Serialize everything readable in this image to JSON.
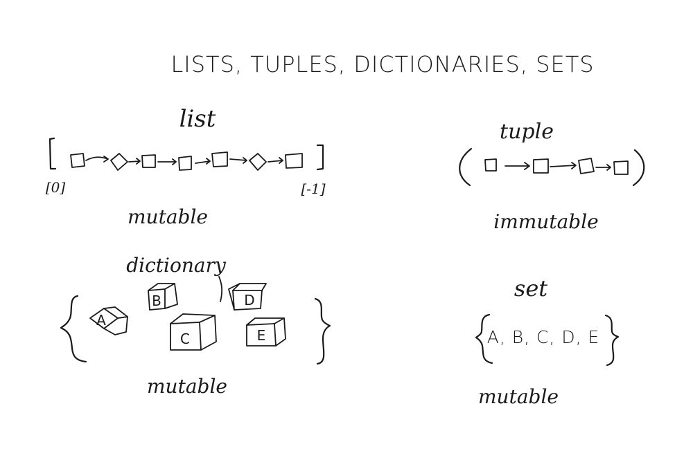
{
  "title": "LISTS, TUPLES, DICTIONARIES, SETS",
  "list": {
    "heading": "list",
    "first_index": "[0]",
    "last_index": "[-1]",
    "mutability": "mutable"
  },
  "tuple": {
    "heading": "tuple",
    "mutability": "immutable"
  },
  "dictionary": {
    "heading": "dictionary",
    "items": [
      "A",
      "B",
      "C",
      "D",
      "E"
    ],
    "mutability": "mutable"
  },
  "set": {
    "heading": "set",
    "content": "A, B, C, D, E",
    "mutability": "mutable"
  }
}
